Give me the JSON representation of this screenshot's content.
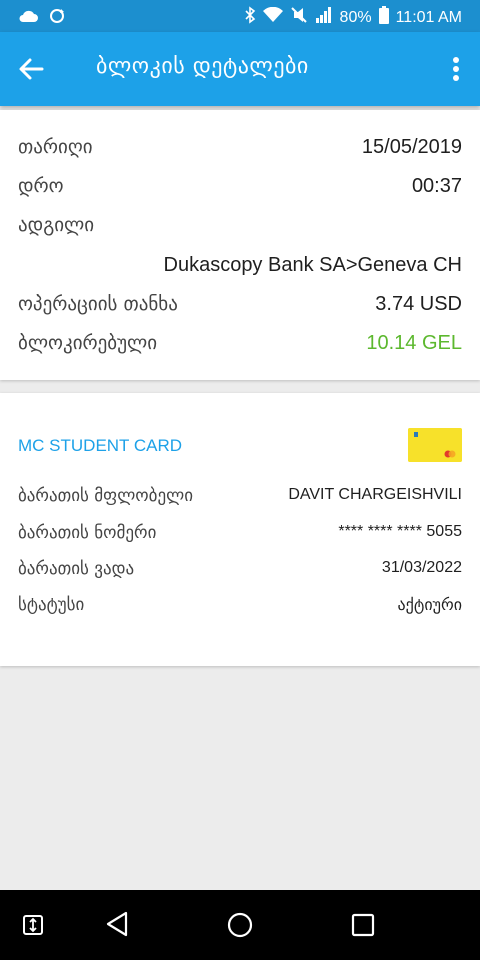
{
  "status_bar": {
    "battery": "80%",
    "time": "11:01 AM",
    "icons": [
      "cloud-icon",
      "sync-icon",
      "bluetooth-icon",
      "wifi-icon",
      "mute-icon",
      "signal-icon",
      "battery-icon"
    ]
  },
  "app_bar": {
    "title": "ბლოკის დეტალები",
    "back_icon": "arrow-back-icon",
    "menu_icon": "more-vert-icon"
  },
  "transaction": {
    "date_label": "თარიღი",
    "date_value": "15/05/2019",
    "time_label": "დრო",
    "time_value": "00:37",
    "place_label": "ადგილი",
    "place_value": "Dukascopy Bank SA>Geneva CH",
    "amount_label": "ოპერაციის თანხა",
    "amount_value": "3.74 USD",
    "blocked_label": "ბლოკირებული",
    "blocked_value": "10.14 GEL"
  },
  "card": {
    "name": "MC STUDENT CARD",
    "holder_label": "ბარათის მფლობელი",
    "holder_value": "DAVIT CHARGEISHVILI",
    "number_label": "ბარათის ნომერი",
    "number_value": "**** **** **** 5055",
    "expiry_label": "ბარათის ვადა",
    "expiry_value": "31/03/2022",
    "status_label": "სტატუსი",
    "status_value": "აქტიური"
  },
  "colors": {
    "app_bar": "#1da1e8",
    "status_bar": "#1c8fcf",
    "accent_green": "#5cb82e",
    "card_yellow": "#f7e12a"
  },
  "nav_bar": {
    "icons": [
      "screen-pin-icon",
      "back-icon",
      "home-icon",
      "recents-icon"
    ]
  }
}
